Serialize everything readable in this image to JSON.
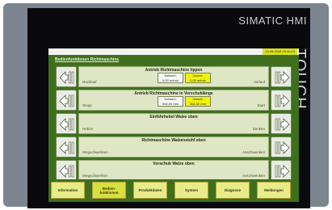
{
  "device": {
    "brand": "SIMATIC HMI",
    "side_label": "TOUCH"
  },
  "header": {
    "datetime": "15.05.2018 16:40:13"
  },
  "panel": {
    "title": "Bedienfunktionen Richtmaschine"
  },
  "rows": [
    {
      "title": "Antrieb Richtmaschine tippen",
      "left": "Rücklauf",
      "right": "Vorlauf",
      "soll_label": "Sollwert:",
      "soll_value": "5,00 m/min",
      "ist_label": "Istwert:",
      "ist_value": "0,00 m/min"
    },
    {
      "title": "Antrieb Richtmaschine in Vorschublänge",
      "left": "Stopp",
      "right": "Start",
      "soll_label": "Sollwert:",
      "soll_value": "354,00 mm",
      "ist_label": "Istwert:",
      "ist_value": "354,00 mm"
    },
    {
      "title": "Einführhebel Walze oben",
      "left": "Heben",
      "right": "Senken"
    },
    {
      "title": "Richtmaschine Walzenstuhl oben",
      "left": "Wegschwenken",
      "right": "Anschwenken"
    },
    {
      "title": "Vorschub Walze oben",
      "left": "Wegschwenken",
      "right": "Anschwenken"
    }
  ],
  "tabs": [
    {
      "label": "Information"
    },
    {
      "label": "Bedien-\nfunktionen"
    },
    {
      "label": "Produktdaten"
    },
    {
      "label": "System"
    },
    {
      "label": "Diagnose"
    },
    {
      "label": "Meldungen"
    }
  ],
  "colors": {
    "panel_green": "#3f6f1d",
    "tab_yellow": "#e8ec88",
    "ist_yellow": "#f1f10d"
  },
  "icons": {
    "left_button": "arrow-left-icon",
    "right_button": "arrow-right-icon"
  }
}
